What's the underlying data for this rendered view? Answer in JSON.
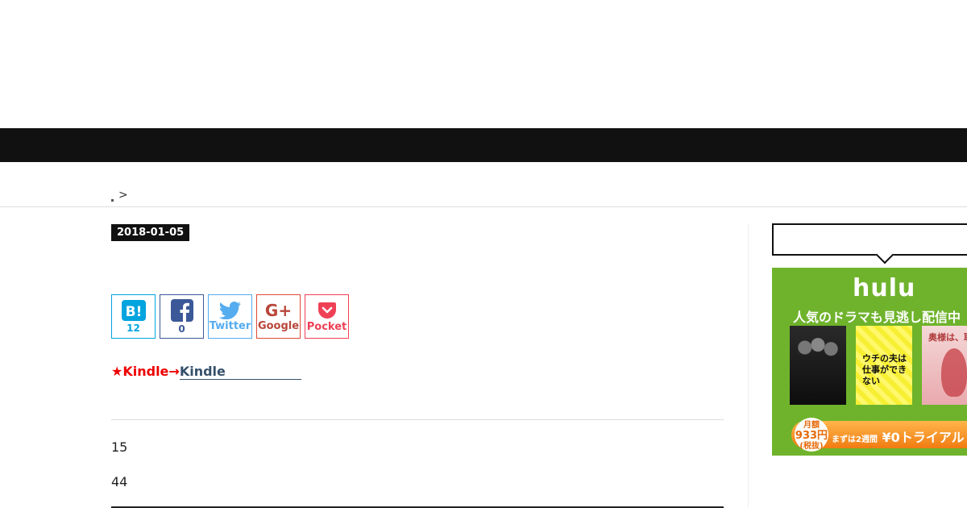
{
  "breadcrumb": {
    "separator": ">"
  },
  "post": {
    "date": "2018-01-05",
    "kindle_prefix": "★Kindle→",
    "kindle_link": "Kindle",
    "paragraphs": [
      "15",
      "44"
    ]
  },
  "share": {
    "hatena": {
      "label": "B!",
      "count": "12"
    },
    "facebook": {
      "label": "f",
      "count": "0"
    },
    "twitter": {
      "label": "Twitter"
    },
    "google": {
      "label": "Google",
      "glyph": "G+"
    },
    "pocket": {
      "label": "Pocket"
    }
  },
  "sidebar_ad": {
    "logo": "hulu",
    "tagline": "人気のドラマも見逃し配信中",
    "poster2_text": "ウチの夫は仕事ができない",
    "poster3_text": "奥様は、取り扱い注意",
    "price_label": "月額",
    "price_value": "933円",
    "price_note": "(税抜)",
    "cta_prefix": "まずは2週間",
    "cta_text": "¥0トライアル"
  },
  "colors": {
    "navbar": "#111111",
    "hatena": "#00a4de",
    "facebook": "#3b5998",
    "twitter": "#55acee",
    "google": "#dd4b39",
    "pocket": "#ef4056",
    "kindle_red": "#ee0000",
    "hulu_green": "#6fb32c"
  }
}
